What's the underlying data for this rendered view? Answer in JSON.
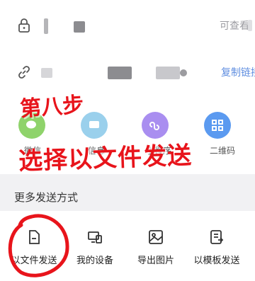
{
  "rows": [
    {
      "icon": "lock-icon",
      "right_text": "可查看"
    },
    {
      "icon": "link-icon",
      "right_text": "复制链接"
    }
  ],
  "share_options": [
    {
      "icon": "wechat-icon",
      "label": "微信",
      "color": "#8fd36b"
    },
    {
      "icon": "message-icon",
      "label": "信息",
      "color": "#9ad0ec"
    },
    {
      "icon": "miniprogram-icon",
      "label": "小程序",
      "color": "#a98ef0"
    },
    {
      "icon": "qrcode-icon",
      "label": "二维码",
      "color": "#5b9af0"
    }
  ],
  "section_title": "更多发送方式",
  "more_options": [
    {
      "icon": "file-icon",
      "label": "以文件发送"
    },
    {
      "icon": "device-icon",
      "label": "我的设备"
    },
    {
      "icon": "image-icon",
      "label": "导出图片"
    },
    {
      "icon": "template-icon",
      "label": "以模板发送"
    }
  ],
  "annotation": {
    "step": "第八步",
    "instruction": "选择以文件发送",
    "color": "#e8141b"
  }
}
